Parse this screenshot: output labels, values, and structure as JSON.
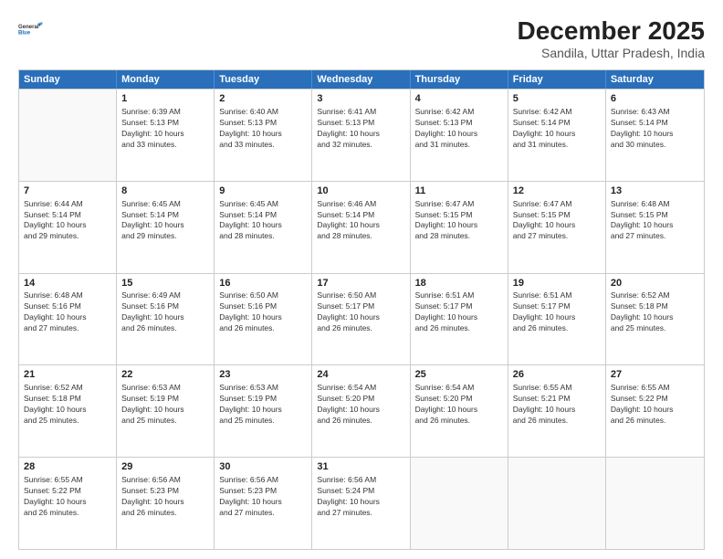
{
  "header": {
    "logo_line1": "General",
    "logo_line2": "Blue",
    "month": "December 2025",
    "location": "Sandila, Uttar Pradesh, India"
  },
  "days_of_week": [
    "Sunday",
    "Monday",
    "Tuesday",
    "Wednesday",
    "Thursday",
    "Friday",
    "Saturday"
  ],
  "weeks": [
    [
      {
        "day": "",
        "text": ""
      },
      {
        "day": "1",
        "text": "Sunrise: 6:39 AM\nSunset: 5:13 PM\nDaylight: 10 hours\nand 33 minutes."
      },
      {
        "day": "2",
        "text": "Sunrise: 6:40 AM\nSunset: 5:13 PM\nDaylight: 10 hours\nand 33 minutes."
      },
      {
        "day": "3",
        "text": "Sunrise: 6:41 AM\nSunset: 5:13 PM\nDaylight: 10 hours\nand 32 minutes."
      },
      {
        "day": "4",
        "text": "Sunrise: 6:42 AM\nSunset: 5:13 PM\nDaylight: 10 hours\nand 31 minutes."
      },
      {
        "day": "5",
        "text": "Sunrise: 6:42 AM\nSunset: 5:14 PM\nDaylight: 10 hours\nand 31 minutes."
      },
      {
        "day": "6",
        "text": "Sunrise: 6:43 AM\nSunset: 5:14 PM\nDaylight: 10 hours\nand 30 minutes."
      }
    ],
    [
      {
        "day": "7",
        "text": "Sunrise: 6:44 AM\nSunset: 5:14 PM\nDaylight: 10 hours\nand 29 minutes."
      },
      {
        "day": "8",
        "text": "Sunrise: 6:45 AM\nSunset: 5:14 PM\nDaylight: 10 hours\nand 29 minutes."
      },
      {
        "day": "9",
        "text": "Sunrise: 6:45 AM\nSunset: 5:14 PM\nDaylight: 10 hours\nand 28 minutes."
      },
      {
        "day": "10",
        "text": "Sunrise: 6:46 AM\nSunset: 5:14 PM\nDaylight: 10 hours\nand 28 minutes."
      },
      {
        "day": "11",
        "text": "Sunrise: 6:47 AM\nSunset: 5:15 PM\nDaylight: 10 hours\nand 28 minutes."
      },
      {
        "day": "12",
        "text": "Sunrise: 6:47 AM\nSunset: 5:15 PM\nDaylight: 10 hours\nand 27 minutes."
      },
      {
        "day": "13",
        "text": "Sunrise: 6:48 AM\nSunset: 5:15 PM\nDaylight: 10 hours\nand 27 minutes."
      }
    ],
    [
      {
        "day": "14",
        "text": "Sunrise: 6:48 AM\nSunset: 5:16 PM\nDaylight: 10 hours\nand 27 minutes."
      },
      {
        "day": "15",
        "text": "Sunrise: 6:49 AM\nSunset: 5:16 PM\nDaylight: 10 hours\nand 26 minutes."
      },
      {
        "day": "16",
        "text": "Sunrise: 6:50 AM\nSunset: 5:16 PM\nDaylight: 10 hours\nand 26 minutes."
      },
      {
        "day": "17",
        "text": "Sunrise: 6:50 AM\nSunset: 5:17 PM\nDaylight: 10 hours\nand 26 minutes."
      },
      {
        "day": "18",
        "text": "Sunrise: 6:51 AM\nSunset: 5:17 PM\nDaylight: 10 hours\nand 26 minutes."
      },
      {
        "day": "19",
        "text": "Sunrise: 6:51 AM\nSunset: 5:17 PM\nDaylight: 10 hours\nand 26 minutes."
      },
      {
        "day": "20",
        "text": "Sunrise: 6:52 AM\nSunset: 5:18 PM\nDaylight: 10 hours\nand 25 minutes."
      }
    ],
    [
      {
        "day": "21",
        "text": "Sunrise: 6:52 AM\nSunset: 5:18 PM\nDaylight: 10 hours\nand 25 minutes."
      },
      {
        "day": "22",
        "text": "Sunrise: 6:53 AM\nSunset: 5:19 PM\nDaylight: 10 hours\nand 25 minutes."
      },
      {
        "day": "23",
        "text": "Sunrise: 6:53 AM\nSunset: 5:19 PM\nDaylight: 10 hours\nand 25 minutes."
      },
      {
        "day": "24",
        "text": "Sunrise: 6:54 AM\nSunset: 5:20 PM\nDaylight: 10 hours\nand 26 minutes."
      },
      {
        "day": "25",
        "text": "Sunrise: 6:54 AM\nSunset: 5:20 PM\nDaylight: 10 hours\nand 26 minutes."
      },
      {
        "day": "26",
        "text": "Sunrise: 6:55 AM\nSunset: 5:21 PM\nDaylight: 10 hours\nand 26 minutes."
      },
      {
        "day": "27",
        "text": "Sunrise: 6:55 AM\nSunset: 5:22 PM\nDaylight: 10 hours\nand 26 minutes."
      }
    ],
    [
      {
        "day": "28",
        "text": "Sunrise: 6:55 AM\nSunset: 5:22 PM\nDaylight: 10 hours\nand 26 minutes."
      },
      {
        "day": "29",
        "text": "Sunrise: 6:56 AM\nSunset: 5:23 PM\nDaylight: 10 hours\nand 26 minutes."
      },
      {
        "day": "30",
        "text": "Sunrise: 6:56 AM\nSunset: 5:23 PM\nDaylight: 10 hours\nand 27 minutes."
      },
      {
        "day": "31",
        "text": "Sunrise: 6:56 AM\nSunset: 5:24 PM\nDaylight: 10 hours\nand 27 minutes."
      },
      {
        "day": "",
        "text": ""
      },
      {
        "day": "",
        "text": ""
      },
      {
        "day": "",
        "text": ""
      }
    ]
  ]
}
